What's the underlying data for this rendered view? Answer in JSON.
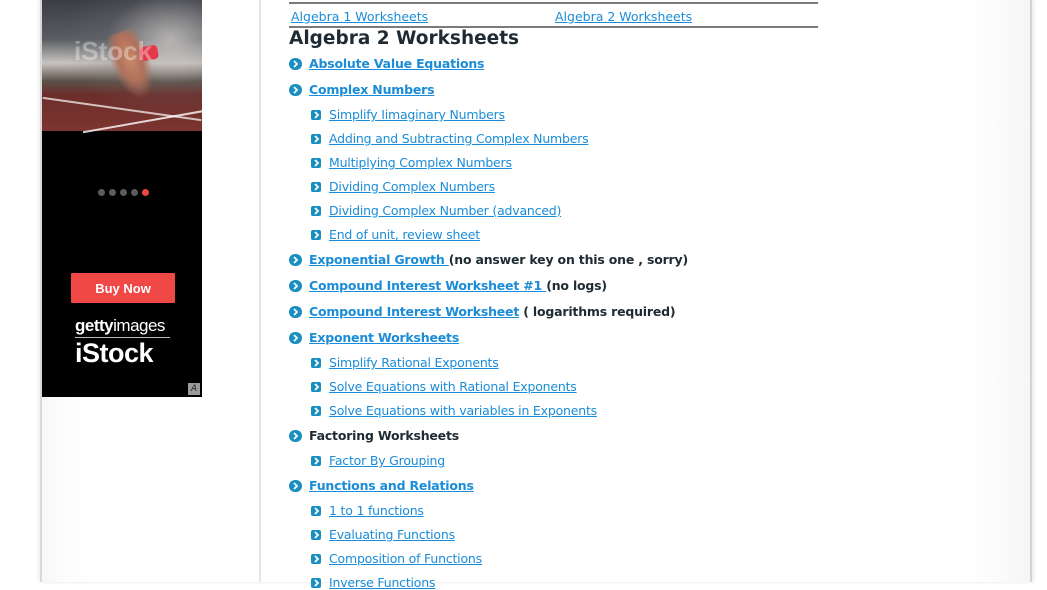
{
  "ad": {
    "watermark": "iStock",
    "carousel": {
      "total": 5,
      "active_index": 4
    },
    "buy_button": "Buy Now",
    "brand_line1_bold": "getty",
    "brand_line1_rest": "images",
    "brand_line2": "iStock",
    "adchoices_icon": "adchoices-icon",
    "colors": {
      "button": "#f04846",
      "dot_active": "#ef4444",
      "dot": "#5d5d5d"
    }
  },
  "topnav": {
    "links": [
      {
        "label": "Algebra 1 Worksheets"
      },
      {
        "label": "Algebra 2 Worksheets"
      }
    ]
  },
  "page_title": "Algebra 2 Worksheets",
  "colors": {
    "link": "#1a8cd8",
    "bullet": "#1a8fbf",
    "text": "#1e2b33"
  },
  "items": [
    {
      "level": 1,
      "label": "Absolute Value Equations",
      "link": true,
      "note": ""
    },
    {
      "level": 1,
      "label": "Complex Numbers",
      "link": true,
      "note": ""
    },
    {
      "level": 2,
      "label": "Simplify Iimaginary Numbers",
      "link": true,
      "note": ""
    },
    {
      "level": 2,
      "label": "Adding and Subtracting Complex Numbers",
      "link": true,
      "note": ""
    },
    {
      "level": 2,
      "label": "Multiplying Complex Numbers",
      "link": true,
      "note": ""
    },
    {
      "level": 2,
      "label": "Dividing Complex Numbers",
      "link": true,
      "note": ""
    },
    {
      "level": 2,
      "label": "Dividing Complex Number (advanced)",
      "link": true,
      "note": ""
    },
    {
      "level": 2,
      "label": "End of unit, review sheet",
      "link": true,
      "note": ""
    },
    {
      "level": 1,
      "label": "Exponential Growth ",
      "link": true,
      "note": "(no answer key on this one , sorry)"
    },
    {
      "level": 1,
      "label": "Compound Interest Worksheet #1 ",
      "link": true,
      "note": "(no logs)"
    },
    {
      "level": 1,
      "label": "Compound Interest Worksheet",
      "link": true,
      "note": " ( logarithms required)"
    },
    {
      "level": 1,
      "label": "Exponent Worksheets",
      "link": true,
      "note": ""
    },
    {
      "level": 2,
      "label": "Simplify Rational Exponents",
      "link": true,
      "note": ""
    },
    {
      "level": 2,
      "label": "Solve Equations with Rational Exponents",
      "link": true,
      "note": ""
    },
    {
      "level": 2,
      "label": "Solve Equations with variables in Exponents",
      "link": true,
      "note": ""
    },
    {
      "level": 1,
      "label": "Factoring Worksheets",
      "link": false,
      "note": ""
    },
    {
      "level": 2,
      "label": "Factor By Grouping",
      "link": true,
      "note": ""
    },
    {
      "level": 1,
      "label": "Functions and Relations",
      "link": true,
      "note": ""
    },
    {
      "level": 2,
      "label": "1 to 1 functions",
      "link": true,
      "note": ""
    },
    {
      "level": 2,
      "label": "Evaluating Functions",
      "link": true,
      "note": ""
    },
    {
      "level": 2,
      "label": "Composition of Functions",
      "link": true,
      "note": ""
    },
    {
      "level": 2,
      "label": "Inverse Functions",
      "link": true,
      "note": ""
    }
  ]
}
